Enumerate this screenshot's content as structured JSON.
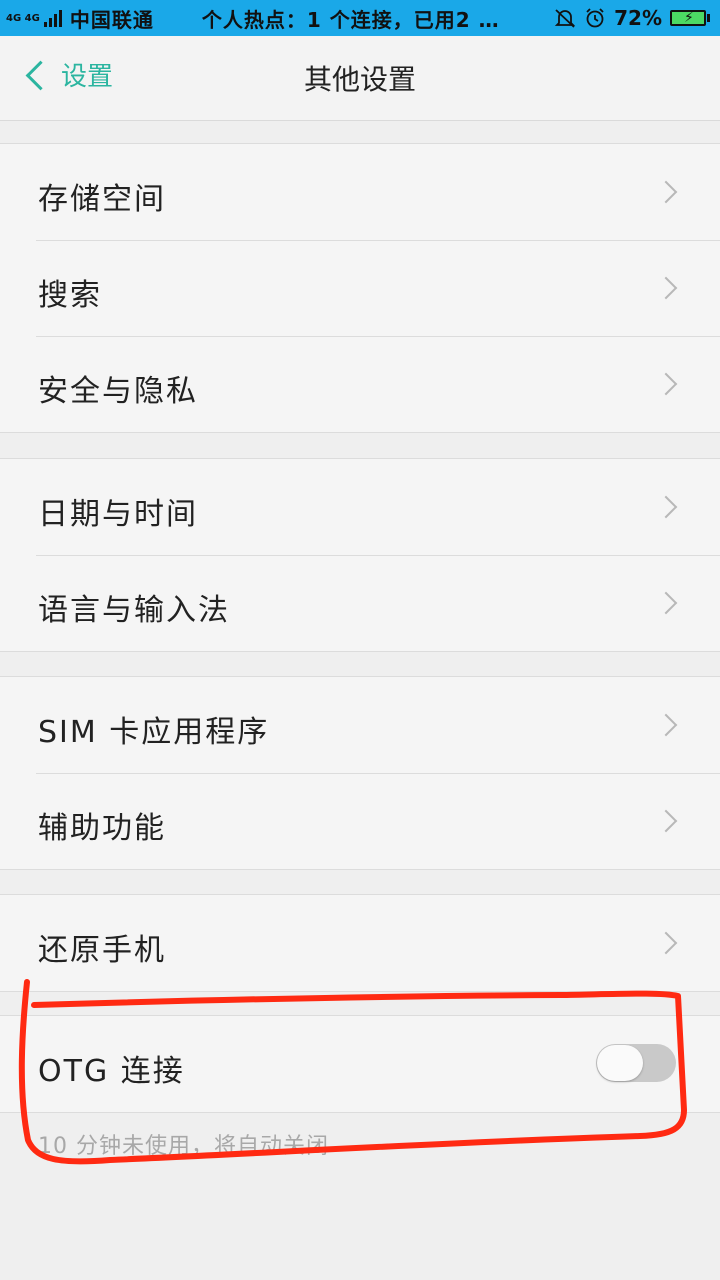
{
  "status_bar": {
    "network": "4G 4G",
    "carrier": "中国联通",
    "notification": "个人热点：1 个连接，已用2 …",
    "battery": "72%",
    "battery_level": 0.72
  },
  "header": {
    "back_label": "设置",
    "title": "其他设置"
  },
  "groups": [
    {
      "items": [
        {
          "label": "存储空间"
        },
        {
          "label": "搜索"
        },
        {
          "label": "安全与隐私"
        }
      ]
    },
    {
      "items": [
        {
          "label": "日期与时间"
        },
        {
          "label": "语言与输入法"
        }
      ]
    },
    {
      "items": [
        {
          "label": "SIM 卡应用程序"
        },
        {
          "label": "辅助功能"
        }
      ]
    },
    {
      "items": [
        {
          "label": "还原手机"
        }
      ]
    }
  ],
  "otg": {
    "label": "OTG 连接",
    "enabled": false,
    "note": "10 分钟未使用，将自动关闭"
  },
  "colors": {
    "status_bar": "#1aa8e8",
    "accent": "#2bb5a0",
    "annotation": "#ff2a12"
  }
}
